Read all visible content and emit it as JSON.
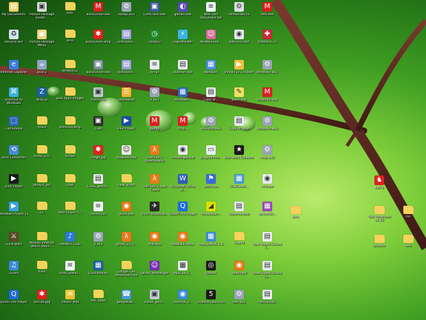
{
  "desktop": {
    "icons": [
      {
        "label": "My Documents",
        "icon": "documents-icon",
        "color": "#f0d06a",
        "glyph": "▤"
      },
      {
        "label": "Picture Package Install...",
        "icon": "installer-icon",
        "color": "#d9d9d9",
        "glyph": "▣"
      },
      {
        "label": "kids",
        "icon": "folder-icon",
        "color": "#f3d35b",
        "glyph": ""
      },
      {
        "label": "autorunner.exe",
        "icon": "mario-icon",
        "color": "#d82020",
        "glyph": "M"
      },
      {
        "label": "swasp.au3",
        "icon": "script-icon",
        "color": "#9aa4b4",
        "glyph": "⚙"
      },
      {
        "label": "CertCrack.exe",
        "icon": "exe-icon",
        "color": "#3a5a9c",
        "glyph": "▣"
      },
      {
        "label": "games.exe",
        "icon": "game-icon",
        "color": "#5a4ab8",
        "glyph": "◐"
      },
      {
        "label": "New Text Document.txt",
        "icon": "text-file-icon",
        "color": "#eef2f6",
        "glyph": "≡"
      },
      {
        "label": "ResHacker.ini",
        "icon": "settings-file-icon",
        "color": "#d8dde3",
        "glyph": "⚙"
      },
      {
        "label": "test.exe",
        "icon": "mario-icon",
        "color": "#d82020",
        "glyph": "M"
      },
      {
        "label": "Recycle Bin",
        "icon": "recycle-bin-icon",
        "color": "#d2e2ee",
        "glyph": "♻"
      },
      {
        "label": "Picture Package Menu",
        "icon": "package-icon",
        "color": "#e9d27c",
        "glyph": "▣"
      },
      {
        "label": "bins",
        "icon": "folder-icon",
        "color": "#f3d35b",
        "glyph": ""
      },
      {
        "label": "autorunner.bmp",
        "icon": "splat-icon",
        "color": "#e02020",
        "glyph": "✱"
      },
      {
        "label": "FastStone...",
        "icon": "app-icon",
        "color": "#9b9fd6",
        "glyph": "▤"
      },
      {
        "label": "clock03",
        "icon": "clock-icon",
        "color": "#1f8a2a",
        "glyph": "◷"
      },
      {
        "label": "LogicMeister",
        "icon": "logic-icon",
        "color": "#3cb4e6",
        "glyph": "⚡"
      },
      {
        "label": "NEWbieTool...",
        "icon": "newbie-icon",
        "color": "#d86a9a",
        "glyph": "☺"
      },
      {
        "label": "antivirus.bat",
        "icon": "batch-icon",
        "color": "#e6eaee",
        "glyph": "◉"
      },
      {
        "label": "testbrain.70",
        "icon": "uk-flag-icon",
        "color": "#c62d3c",
        "glyph": "✚"
      },
      {
        "label": "Internet Explorer",
        "icon": "internet-explorer-icon",
        "color": "#3a7ae0",
        "glyph": "e"
      },
      {
        "label": "Java 2",
        "icon": "java-icon",
        "color": "#8ea4c4",
        "glyph": "☕"
      },
      {
        "label": "lamb2012",
        "icon": "folder-icon",
        "color": "#f3d35b",
        "glyph": ""
      },
      {
        "label": "autorunner.exe",
        "icon": "exe-icon",
        "color": "#7a8a9a",
        "glyph": "▣"
      },
      {
        "label": "FastStone...",
        "icon": "app-icon",
        "color": "#9b9fd6",
        "glyph": "▤"
      },
      {
        "label": "script",
        "icon": "script-icon",
        "color": "#e8ecf0",
        "glyph": "≡"
      },
      {
        "label": "autorun.exe",
        "icon": "exe-icon",
        "color": "#e8ecf0",
        "glyph": "▤"
      },
      {
        "label": "Notepad",
        "icon": "notepad-icon",
        "color": "#4e8de0",
        "glyph": "▦"
      },
      {
        "label": "Pinna FLV Encoder",
        "icon": "encoder-icon",
        "color": "#f0c040",
        "glyph": "▶"
      },
      {
        "label": "testbrain.au3",
        "icon": "script-icon",
        "color": "#9aa4b4",
        "glyph": "⚙"
      },
      {
        "label": "Shortcut to Windows",
        "icon": "shortcut-icon",
        "color": "#3ab0d8",
        "glyph": "⌘"
      },
      {
        "label": "WinZip",
        "icon": "winzip-icon",
        "color": "#1c5ea4",
        "glyph": "Z"
      },
      {
        "label": "Java Apps Images",
        "icon": "folder-icon",
        "color": "#f3d35b",
        "glyph": ""
      },
      {
        "label": "AutoSmrt",
        "icon": "app-icon",
        "color": "#c0c8d0",
        "glyph": "▣"
      },
      {
        "label": "jarbrowser",
        "icon": "browser-icon",
        "color": "#f0b030",
        "glyph": "☰"
      },
      {
        "label": "h.au3",
        "icon": "script-icon",
        "color": "#9aa4b4",
        "glyph": "⚙"
      },
      {
        "label": "Windows...",
        "icon": "windows-icon",
        "color": "#2e6ab8",
        "glyph": "▦"
      },
      {
        "label": "Copy of...",
        "icon": "document-icon",
        "color": "#e8ecf0",
        "glyph": "▤"
      },
      {
        "label": "paint.exe",
        "icon": "paint-icon",
        "color": "#f0e060",
        "glyph": "✎"
      },
      {
        "label": "testbrain.exe",
        "icon": "mario-icon",
        "color": "#d82020",
        "glyph": "M"
      },
      {
        "label": "CamStudio",
        "icon": "camstudio-icon",
        "color": "#2e6ab8",
        "glyph": "⬚"
      },
      {
        "label": "Allkill",
        "icon": "folder-icon",
        "color": "#f3d35b",
        "glyph": ""
      },
      {
        "label": "antivirus.bmp",
        "icon": "folder-icon",
        "color": "#f3d35b",
        "glyph": ""
      },
      {
        "label": "Cam",
        "icon": "cam-icon",
        "color": "#2a2a2a",
        "glyph": "▣"
      },
      {
        "label": "PSP Player",
        "icon": "psp-icon",
        "color": "#1c4aa8",
        "glyph": "▶"
      },
      {
        "label": "gjump",
        "icon": "image-icon",
        "color": "#d82020",
        "glyph": "M"
      },
      {
        "label": "thtp...",
        "icon": "mario-icon",
        "color": "#d82020",
        "glyph": "M"
      },
      {
        "label": "scientist.au3",
        "icon": "script-icon",
        "color": "#9aa4b4",
        "glyph": "⚙"
      },
      {
        "label": "Copy of spad",
        "icon": "document-icon",
        "color": "#e8ecf0",
        "glyph": "▤"
      },
      {
        "label": "testbrain.au3",
        "icon": "script-icon",
        "color": "#9aa4b4",
        "glyph": "⚙"
      },
      {
        "label": "DivX Converter",
        "icon": "divx-converter-icon",
        "color": "#4a8ad8",
        "glyph": "⟲"
      },
      {
        "label": "Audio_101",
        "icon": "folder-icon",
        "color": "#f3d35b",
        "glyph": ""
      },
      {
        "label": "school",
        "icon": "folder-icon",
        "color": "#f3d35b",
        "glyph": ""
      },
      {
        "label": "mega.jpg",
        "icon": "splat-icon",
        "color": "#e02020",
        "glyph": "✱"
      },
      {
        "label": "Mewtwo.exe",
        "icon": "character-icon",
        "color": "#e8e8e8",
        "glyph": "☺"
      },
      {
        "label": "Half-Life 2 Deathmatch",
        "icon": "half-life-icon",
        "color": "#e87a1a",
        "glyph": "λ"
      },
      {
        "label": "messenger.bat",
        "icon": "batch-icon",
        "color": "#e6eaee",
        "glyph": "◉"
      },
      {
        "label": "programma...",
        "icon": "window-icon",
        "color": "#e8ecf0",
        "glyph": "▭"
      },
      {
        "label": "Star Wars Galaxies",
        "icon": "star-wars-icon",
        "color": "#1a1a1a",
        "glyph": "★"
      },
      {
        "label": "mop.au3",
        "icon": "script-icon",
        "color": "#9aa4b4",
        "glyph": "⚙"
      },
      {
        "label": "DivX Player",
        "icon": "divx-player-icon",
        "color": "#1a1a1a",
        "glyph": "▶"
      },
      {
        "label": "benlyrt_arc",
        "icon": "folder-icon",
        "color": "#f3d35b",
        "glyph": ""
      },
      {
        "label": "DAK",
        "icon": "folder-icon",
        "color": "#f3d35b",
        "glyph": ""
      },
      {
        "label": "CARS_welco...",
        "icon": "document-icon",
        "color": "#e8ecf0",
        "glyph": "▤"
      },
      {
        "label": "new_shots",
        "icon": "folder-icon",
        "color": "#f3d35b",
        "glyph": ""
      },
      {
        "label": "Half-Life 2 Lost Coast",
        "icon": "half-life-icon",
        "color": "#e87a1a",
        "glyph": "λ"
      },
      {
        "label": "Microsoft Office W...",
        "icon": "word-icon",
        "color": "#2e5eb8",
        "glyph": "W"
      },
      {
        "label": "path.exe",
        "icon": "path-icon",
        "color": "#3a6ad8",
        "glyph": "⚑"
      },
      {
        "label": "SCMCodel...",
        "icon": "app-icon",
        "color": "#4a9ad8",
        "glyph": "▦"
      },
      {
        "label": "nnd.bat",
        "icon": "batch-icon",
        "color": "#e6eaee",
        "glyph": "◉"
      },
      {
        "label": "Windows Player 11",
        "icon": "media-player-icon",
        "color": "#3aa0e0",
        "glyph": "▶"
      },
      {
        "label": "c2",
        "icon": "folder-icon",
        "color": "#f3d35b",
        "glyph": ""
      },
      {
        "label": "NAV Player (C)",
        "icon": "folder-icon",
        "color": "#f3d35b",
        "glyph": ""
      },
      {
        "label": "cachin.txt",
        "icon": "text-file-icon",
        "color": "#eef2f6",
        "glyph": "≡"
      },
      {
        "label": "pluss.exe",
        "icon": "firefox-icon",
        "color": "#e8781a",
        "glyph": "◉"
      },
      {
        "label": "Pinch Shooting...",
        "icon": "shooter-icon",
        "color": "#2a2a2a",
        "glyph": "✈"
      },
      {
        "label": "QuickTime Player",
        "icon": "quicktime-icon",
        "color": "#1c6ae0",
        "glyph": "Q"
      },
      {
        "label": "Revolution...",
        "icon": "revolution-icon",
        "color": "#e0e000",
        "glyph": "◢"
      },
      {
        "label": "ddservicebat",
        "icon": "batch-icon",
        "color": "#e6eaee",
        "glyph": "▤"
      },
      {
        "label": "winrar(S)...",
        "icon": "winrar-icon",
        "color": "#9a4ab8",
        "glyph": "▦"
      },
      {
        "label": "Guild Wars",
        "icon": "guild-wars-icon",
        "color": "#5a4a2a",
        "glyph": "⚔"
      },
      {
        "label": "Mozilla Internet Worm sourc...",
        "icon": "folder-icon",
        "color": "#f3d35b",
        "glyph": ""
      },
      {
        "label": "AltrMP3 Gold",
        "icon": "mp3-icon",
        "color": "#2a7ad8",
        "glyph": "♪"
      },
      {
        "label": "d.au3",
        "icon": "script-icon",
        "color": "#9aa4b4",
        "glyph": "⚙"
      },
      {
        "label": "gmod_10_5...",
        "icon": "gmod-icon",
        "color": "#e8781a",
        "glyph": "λ"
      },
      {
        "label": "shar.exe",
        "icon": "firefox-icon",
        "color": "#e8781a",
        "glyph": "◉"
      },
      {
        "label": "Mozilla Firefox",
        "icon": "firefox-icon",
        "color": "#e8781a",
        "glyph": "◉"
      },
      {
        "label": "new_HerOS 1.0",
        "icon": "herOS-icon",
        "color": "#3a8ad8",
        "glyph": "▦"
      },
      {
        "label": "Sound",
        "icon": "folder-icon",
        "color": "#f3d35b",
        "glyph": ""
      },
      {
        "label": "New Sound School C...",
        "icon": "document-icon",
        "color": "#e8ecf0",
        "glyph": "▤"
      },
      {
        "label": "iTunes",
        "icon": "itunes-icon",
        "color": "#3a8ad8",
        "glyph": "♫"
      },
      {
        "label": "flash",
        "icon": "folder-icon",
        "color": "#f3d35b",
        "glyph": ""
      },
      {
        "label": "Auto_Stand...",
        "icon": "text-file-icon",
        "color": "#eef2f6",
        "glyph": "≡"
      },
      {
        "label": "Divit Movies",
        "icon": "movie-icon",
        "color": "#1c5ea4",
        "glyph": "▦"
      },
      {
        "label": "Google Talk Received Files",
        "icon": "folder-icon",
        "color": "#f3d35b",
        "glyph": ""
      },
      {
        "label": "Yahoo! Messenger",
        "icon": "yahoo-messenger-icon",
        "color": "#7a2ab8",
        "glyph": "☺"
      },
      {
        "label": "Mp3Con_C...",
        "icon": "app-icon",
        "color": "#e8ecf0",
        "glyph": "▦"
      },
      {
        "label": "Steam",
        "icon": "steam-icon",
        "color": "#1a1a1a",
        "glyph": "◎"
      },
      {
        "label": "searched",
        "icon": "firefox-icon",
        "color": "#e8781a",
        "glyph": "◉"
      },
      {
        "label": "New Sound School Co...",
        "icon": "document-icon",
        "color": "#e8ecf0",
        "glyph": "▤"
      },
      {
        "label": "QuickTime Player",
        "icon": "quicktime-icon",
        "color": "#1c6ae0",
        "glyph": "Q"
      },
      {
        "label": "activat.jpg",
        "icon": "splat-icon",
        "color": "#e02020",
        "glyph": "✱"
      },
      {
        "label": "Yahoo! Mail",
        "icon": "yahoo-mail-icon",
        "color": "#f0c030",
        "glyph": "✉"
      },
      {
        "label": "ABC book",
        "icon": "folder-icon",
        "color": "#f3d35b",
        "glyph": ""
      },
      {
        "label": "googletalk...",
        "icon": "google-talk-icon",
        "color": "#4a9ad8",
        "glyph": "☎"
      },
      {
        "label": "install_gam...",
        "icon": "installer-icon",
        "color": "#c0c8d0",
        "glyph": "▣"
      },
      {
        "label": "mozone_3...",
        "icon": "app-icon",
        "color": "#3a8ad8",
        "glyph": "◉"
      },
      {
        "label": "Shadow Launcher",
        "icon": "shadow-launcher-icon",
        "color": "#1a1a1a",
        "glyph": "5"
      },
      {
        "label": "test.au3",
        "icon": "script-icon",
        "color": "#9aa4b4",
        "glyph": "⚙"
      },
      {
        "label": "~WRL1008...",
        "icon": "document-icon",
        "color": "#e8ecf0",
        "glyph": "▤"
      },
      {
        "label": "AIM 6",
        "icon": "aim-icon",
        "color": "#e02020",
        "glyph": "♞"
      },
      {
        "label": "pics",
        "icon": "folder-icon",
        "color": "#f3d35b",
        "glyph": ""
      },
      {
        "label": "QBI Advanced v1.25",
        "icon": "folder-icon",
        "color": "#f3d35b",
        "glyph": ""
      },
      {
        "label": "css",
        "icon": "folder-icon",
        "color": "#f3d35b",
        "glyph": ""
      },
      {
        "label": "physics",
        "icon": "folder-icon",
        "color": "#f3d35b",
        "glyph": ""
      },
      {
        "label": "web",
        "icon": "folder-icon",
        "color": "#f3d35b",
        "glyph": ""
      }
    ]
  }
}
